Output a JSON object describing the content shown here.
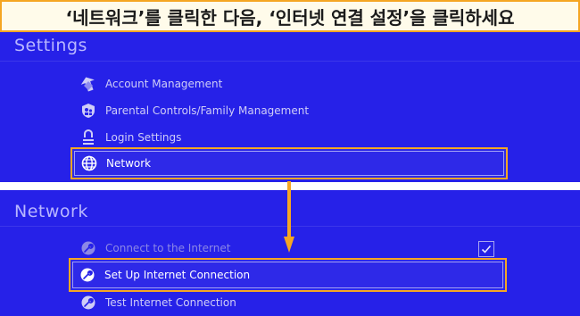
{
  "banner": {
    "text": "‘네트워크’를 클릭한 다음, ‘인터넷 연결 설정’을 클릭하세요"
  },
  "settings": {
    "title": "Settings",
    "items": [
      {
        "label": "Account Management",
        "icon": "account-management-icon"
      },
      {
        "label": "Parental Controls/Family Management",
        "icon": "parental-controls-icon"
      },
      {
        "label": "Login Settings",
        "icon": "login-settings-icon"
      },
      {
        "label": "Network",
        "icon": "globe-icon",
        "selected": true
      }
    ]
  },
  "network": {
    "title": "Network",
    "items": [
      {
        "label": "Connect to the Internet",
        "icon": "wrench-icon",
        "checked": true
      },
      {
        "label": "Set Up Internet Connection",
        "icon": "wrench-icon",
        "selected": true
      },
      {
        "label": "Test Internet Connection",
        "icon": "wrench-icon"
      }
    ]
  },
  "colors": {
    "panel_bg": "#2621e8",
    "highlight": "#f5a623",
    "banner_bg": "#fffbea"
  }
}
